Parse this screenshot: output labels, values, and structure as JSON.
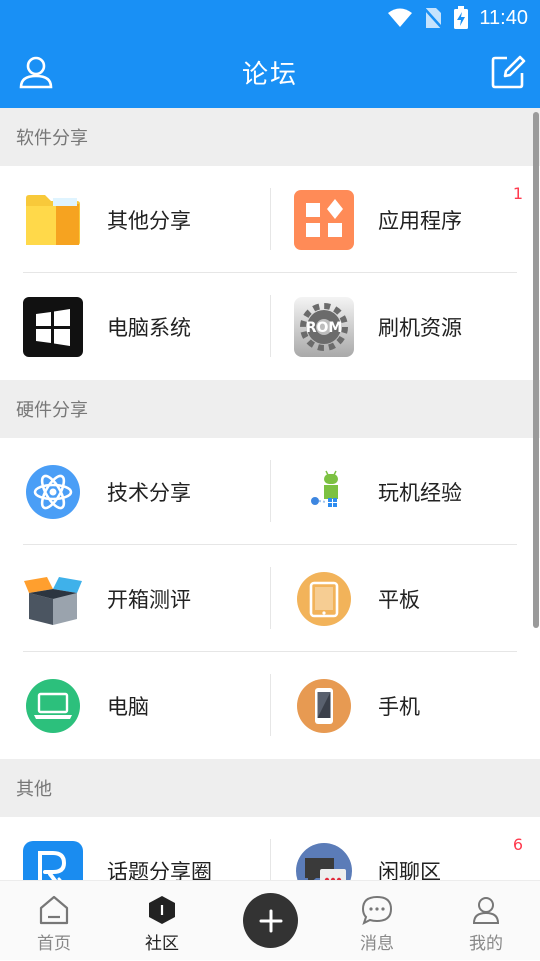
{
  "status_bar": {
    "time": "11:40"
  },
  "header": {
    "title": "论坛"
  },
  "sections": [
    {
      "title": "软件分享",
      "items": [
        {
          "label": "其他分享",
          "icon": "folder-icon",
          "badge": ""
        },
        {
          "label": "应用程序",
          "icon": "apps-icon",
          "badge": "1"
        },
        {
          "label": "电脑系统",
          "icon": "windows-icon",
          "badge": ""
        },
        {
          "label": "刷机资源",
          "icon": "rom-gear-icon",
          "badge": ""
        }
      ]
    },
    {
      "title": "硬件分享",
      "items": [
        {
          "label": "技术分享",
          "icon": "atom-icon",
          "badge": ""
        },
        {
          "label": "玩机经验",
          "icon": "android-icon",
          "badge": ""
        },
        {
          "label": "开箱测评",
          "icon": "open-box-icon",
          "badge": ""
        },
        {
          "label": "平板",
          "icon": "tablet-icon",
          "badge": ""
        },
        {
          "label": "电脑",
          "icon": "laptop-icon",
          "badge": ""
        },
        {
          "label": "手机",
          "icon": "phone-icon",
          "badge": ""
        }
      ]
    },
    {
      "title": "其他",
      "items": [
        {
          "label": "话题分享圈",
          "icon": "topic-icon",
          "badge": ""
        },
        {
          "label": "闲聊区",
          "icon": "chat-icon",
          "badge": "6"
        }
      ]
    }
  ],
  "tabbar": {
    "home": "首页",
    "community": "社区",
    "messages": "消息",
    "mine": "我的",
    "active": "community"
  },
  "colors": {
    "brand": "#1990f5",
    "badge": "#ff3b4f"
  }
}
